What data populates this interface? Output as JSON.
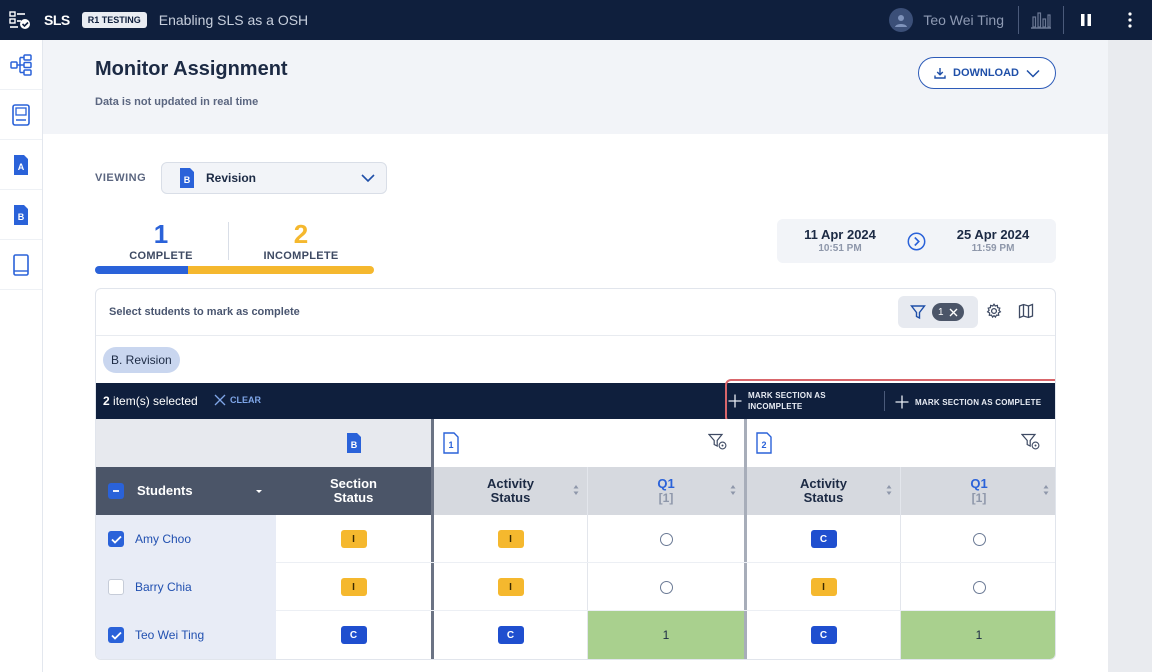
{
  "topbar": {
    "logo": "SLS",
    "badge": "R1 TESTING",
    "title": "Enabling SLS as a OSH",
    "user_name": "Teo Wei Ting"
  },
  "header": {
    "title": "Monitor Assignment",
    "subtitle": "Data is not updated in real time",
    "download_label": "DOWNLOAD"
  },
  "viewing": {
    "label": "VIEWING",
    "selected_icon": "B",
    "selected": "Revision"
  },
  "summary": {
    "complete_count": "1",
    "complete_label": "COMPLETE",
    "incomplete_count": "2",
    "incomplete_label": "INCOMPLETE",
    "complete_fraction": 0.333,
    "colors": {
      "complete": "#2a62d9",
      "incomplete": "#f5b82e"
    }
  },
  "dates": {
    "start_date": "11 Apr 2024",
    "start_time": "10:51 PM",
    "end_date": "25 Apr 2024",
    "end_time": "11:59 PM"
  },
  "table": {
    "hint": "Select students to mark as complete",
    "filter_count": "1",
    "tag": "B. Revision",
    "selection": {
      "count": "2",
      "suffix": " item(s) selected",
      "clear_label": "CLEAR",
      "mark_incomplete_line1": "MARK SECTION AS",
      "mark_incomplete_line2": "INCOMPLETE",
      "mark_complete": "MARK SECTION AS COMPLETE"
    },
    "group_icons": {
      "section": "B",
      "activity1": "1",
      "activity2": "2"
    },
    "columns": {
      "students": "Students",
      "section_status_1": "Section",
      "section_status_2": "Status",
      "activity_status_1": "Activity",
      "activity_status_2": "Status",
      "q1": "Q1",
      "q1_marks": "[1]"
    },
    "rows": [
      {
        "name": "Amy Choo",
        "selected": true,
        "section": "I",
        "act1": "I",
        "q1_1": "",
        "act2": "C",
        "q1_2": ""
      },
      {
        "name": "Barry Chia",
        "selected": false,
        "section": "I",
        "act1": "I",
        "q1_1": "",
        "act2": "I",
        "q1_2": ""
      },
      {
        "name": "Teo Wei Ting",
        "selected": true,
        "section": "C",
        "act1": "C",
        "q1_1": "1",
        "act2": "C",
        "q1_2": "1"
      }
    ]
  }
}
